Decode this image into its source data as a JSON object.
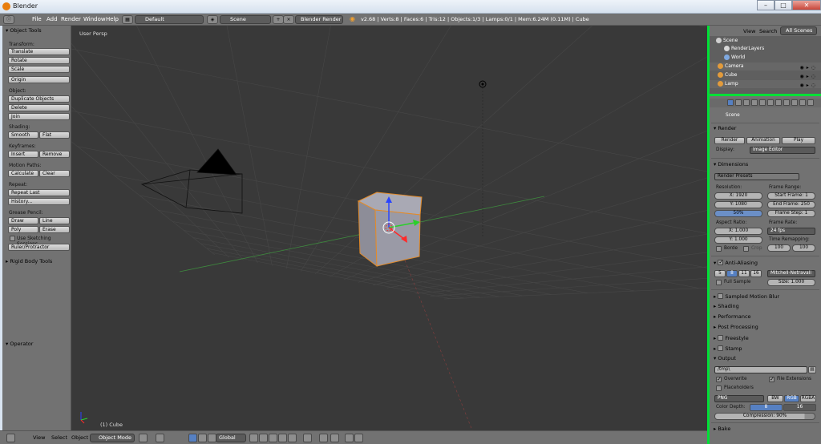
{
  "window": {
    "title": "Blender",
    "min": "–",
    "max": "□",
    "close": "✕"
  },
  "infobar": {
    "menus": [
      "File",
      "Add",
      "Render",
      "Window",
      "Help"
    ],
    "layout": "Default",
    "scene": "Scene",
    "engine": "Blender Render",
    "stats": "v2.68 | Verts:8 | Faces:6 | Tris:12 | Objects:1/3 | Lamps:0/1 | Mem:6.24M (0.11M) | Cube"
  },
  "toolshelf": {
    "header": "Object Tools",
    "transform_label": "Transform:",
    "translate": "Translate",
    "rotate": "Rotate",
    "scale": "Scale",
    "origin": "Origin",
    "object_label": "Object:",
    "duplicate": "Duplicate Objects",
    "delete": "Delete",
    "join": "Join",
    "shading_label": "Shading:",
    "smooth": "Smooth",
    "flat": "Flat",
    "keyframes_label": "Keyframes:",
    "insert": "Insert",
    "remove": "Remove",
    "motion_label": "Motion Paths:",
    "calculate": "Calculate",
    "clear": "Clear",
    "repeat_label": "Repeat:",
    "repeat_last": "Repeat Last",
    "history": "History...",
    "grease_label": "Grease Pencil:",
    "draw": "Draw",
    "line": "Line",
    "poly": "Poly",
    "erase": "Erase",
    "use_sketching": "Use Sketching Sessions",
    "ruler": "Ruler/Protractor",
    "rigid": "Rigid Body Tools",
    "operator": "Operator"
  },
  "viewport": {
    "view_label": "User Persp",
    "object_label": "(1) Cube"
  },
  "viewheader": {
    "view": "View",
    "select": "Select",
    "object": "Object",
    "mode": "Object Mode",
    "orientation": "Global"
  },
  "outliner": {
    "view": "View",
    "search": "Search",
    "scenes": "All Scenes",
    "rows": [
      {
        "label": "Scene",
        "color": "#cfcfcf"
      },
      {
        "label": "RenderLayers",
        "color": "#d8d8d8"
      },
      {
        "label": "World",
        "color": "#7fa9e0"
      },
      {
        "label": "Camera",
        "color": "#e39b3b"
      },
      {
        "label": "Cube",
        "color": "#e39b3b"
      },
      {
        "label": "Lamp",
        "color": "#e39b3b"
      }
    ]
  },
  "properties": {
    "scene": "Scene",
    "render_section": "Render",
    "render_btn": "Render",
    "animation_btn": "Animation",
    "play_btn": "Play",
    "display_label": "Display:",
    "display_value": "Image Editor",
    "dimensions_section": "Dimensions",
    "presets": "Render Presets",
    "resolution_label": "Resolution:",
    "frame_range_label": "Frame Range:",
    "res_x": "X: 1920",
    "res_y": "Y: 1080",
    "res_pct": "50%",
    "start_frame": "Start Frame: 1",
    "end_frame": "End Frame: 250",
    "frame_step": "Frame Step: 1",
    "aspect_label": "Aspect Ratio:",
    "frame_rate_label": "Frame Rate:",
    "aspect_x": "X: 1.000",
    "aspect_y": "Y: 1.000",
    "fps": "24 fps",
    "time_remap_label": "Time Remapping:",
    "remap_old": "100",
    "remap_new": "100",
    "border": "Borde",
    "crop": "Crop",
    "aa_section": "Anti-Aliasing",
    "aa_samples": [
      "5",
      "8",
      "11",
      "16"
    ],
    "aa_filter": "Mitchell-Netravali",
    "full_sample": "Full Sample",
    "aa_size": "Size: 1.000",
    "motion_blur": "Sampled Motion Blur",
    "shading": "Shading",
    "performance": "Performance",
    "post": "Post Processing",
    "freestyle": "Freestyle",
    "stamp": "Stamp",
    "output_section": "Output",
    "output_path": "/tmp\\",
    "overwrite": "Overwrite",
    "file_ext": "File Extensions",
    "placeholders": "Placeholders",
    "format": "PNG",
    "bw": "BW",
    "rgb": "RGB",
    "rgba": "RGBA",
    "color_depth_label": "Color Depth:",
    "depth_8": "8",
    "depth_16": "16",
    "compression": "Compression: 90%",
    "bake": "Bake"
  }
}
